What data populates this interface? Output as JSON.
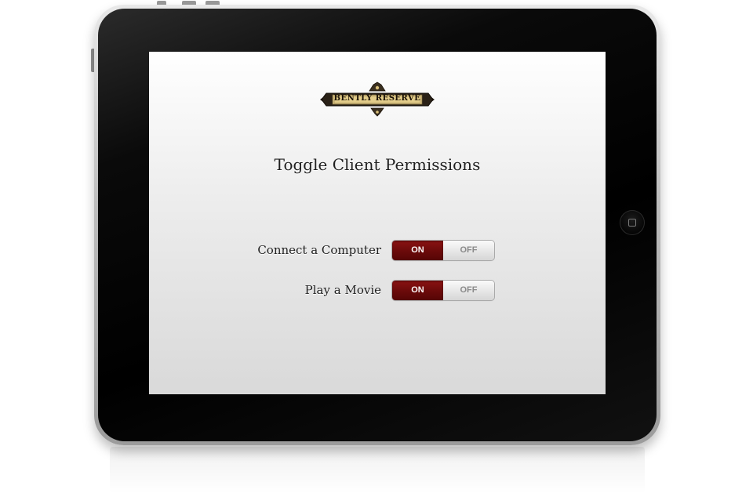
{
  "logo": {
    "text": "BENTLY RESERVE"
  },
  "screen": {
    "title": "Toggle Client Permissions"
  },
  "permissions": [
    {
      "label": "Connect a Computer",
      "on_label": "ON",
      "off_label": "OFF",
      "state": "on"
    },
    {
      "label": "Play a Movie",
      "on_label": "ON",
      "off_label": "OFF",
      "state": "on"
    }
  ],
  "colors": {
    "toggle_on": "#6a0a0a",
    "toggle_off": "#e6e6e6",
    "logo_gold": "#d9c07a",
    "bezel": "#000000"
  },
  "icons": {
    "home_button": "home-square-icon"
  }
}
